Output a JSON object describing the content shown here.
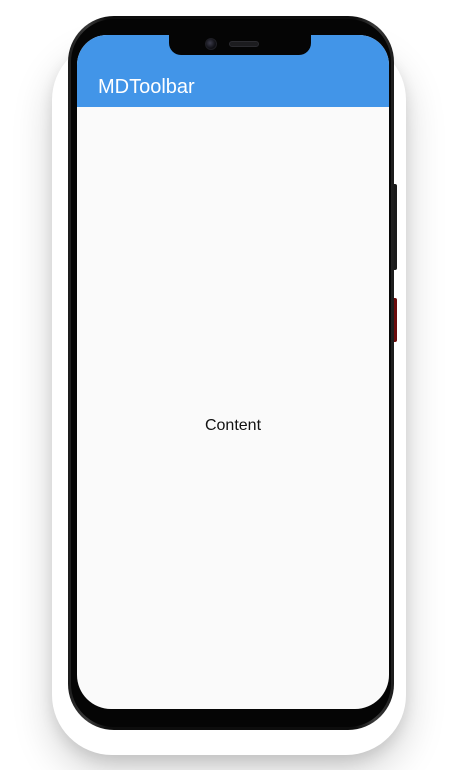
{
  "app_bar": {
    "title": "MDToolbar",
    "background_color": "#4295e8",
    "title_color": "#ffffff"
  },
  "main": {
    "content_text": "Content",
    "background_color": "#fafafa"
  },
  "device": {
    "notch_items": [
      "front-camera-icon",
      "earpiece-speaker-icon"
    ]
  }
}
